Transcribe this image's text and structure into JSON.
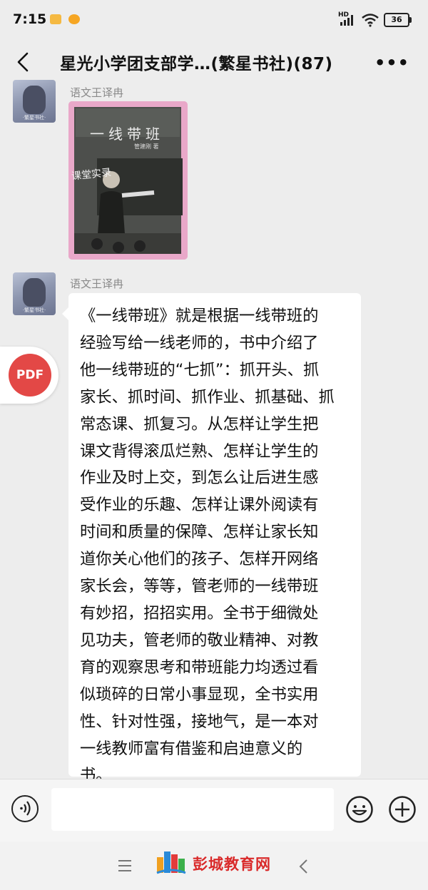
{
  "status": {
    "time": "7:15",
    "network": "HD",
    "battery": "36"
  },
  "header": {
    "title": "星光小学团支部学…(繁星书社)(87)"
  },
  "messages": [
    {
      "sender": "语文王译冉",
      "type": "image",
      "book_title": "一线带班",
      "book_author": "管建刚 著",
      "banner": "课堂实录"
    },
    {
      "sender": "语文王译冉",
      "type": "text",
      "text": "《一线带班》就是根据一线带班的\n经验写给一线老师的，书中介绍了\n他一线带班的“七抓”：抓开头、抓\n家长、抓时间、抓作业、抓基础、抓\n常态课、抓复习。从怎样让学生把\n课文背得滚瓜烂熟、怎样让学生的\n作业及时上交，到怎么让后进生感\n受作业的乐趣、怎样让课外阅读有\n时间和质量的保障、怎样让家长知\n道你关心他们的孩子、怎样开网络\n家长会，等等，管老师的一线带班\n有妙招，招招实用。全书于细微处\n见功夫，管老师的敬业精神、对教\n育的观察思考和带班能力均透过看\n似琐碎的日常小事显现，全书实用\n性、针对性强，接地气，是一本对\n一线教师富有借鉴和启迪意义的\n书。"
    }
  ],
  "pdf_button": {
    "label": "PDF"
  },
  "watermark": {
    "text": "彭城教育网"
  },
  "icons": [
    "back-icon",
    "more-icon",
    "voice-icon",
    "emoji-icon",
    "plus-icon",
    "menu-icon",
    "nav-back-icon",
    "wifi-icon",
    "signal-icon"
  ],
  "colors": {
    "background": "#ededed",
    "pdf": "#e34846",
    "bubble": "#ffffff",
    "watermark": "#d92a2a"
  }
}
